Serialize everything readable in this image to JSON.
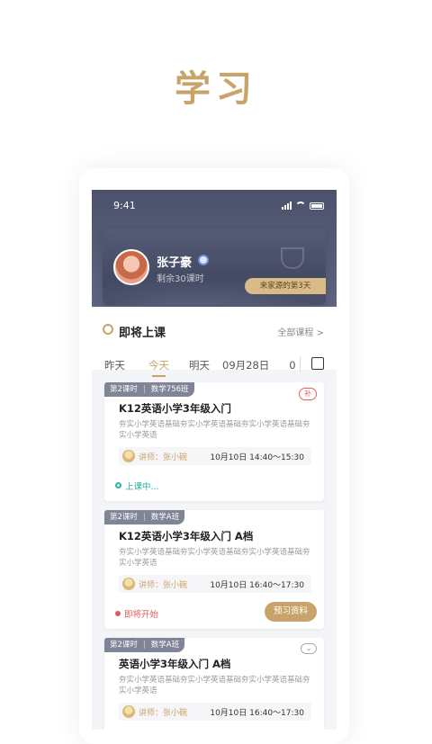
{
  "page": {
    "title": "学习"
  },
  "status_bar": {
    "time": "9:41"
  },
  "profile": {
    "name": "张子豪",
    "remaining": "剩余30课时",
    "badge": "来家源的第3天"
  },
  "upcoming": {
    "title": "即将上课",
    "all_link": "全部课程 >"
  },
  "tabs": [
    {
      "label": "昨天"
    },
    {
      "label": "今天"
    },
    {
      "label": "明天"
    },
    {
      "label": "09月28日"
    },
    {
      "label": "0"
    }
  ],
  "cards": [
    {
      "lesson": "第2课时",
      "class": "数学756班",
      "badge": "补",
      "title": "K12英语小学3年级入门",
      "desc": "夯实小学英语基础夯实小学英语基础夯实小学英语基础夯实小学英语",
      "teacher": "讲师：张小碗",
      "time": "10月10日  14:40～15:30",
      "status": "上课中..."
    },
    {
      "lesson": "第2课时",
      "class": "数学A班",
      "title": "K12英语小学3年级入门 A档",
      "desc": "夯实小学英语基础夯实小学英语基础夯实小学英语基础夯实小学英语",
      "teacher": "讲师：张小碗",
      "time": "10月10日  16:40～17:30",
      "status": "即将开始",
      "button": "预习资料"
    },
    {
      "lesson": "第2课时",
      "class": "数学A班",
      "title": "英语小学3年级入门 A档",
      "desc": "夯实小学英语基础夯实小学英语基础夯实小学英语基础夯实小学英语",
      "teacher": "讲师：张小碗",
      "time": "10月10日  16:40～17:30"
    }
  ],
  "colors": {
    "accent": "#c9a46a",
    "header": "#4c526b",
    "live": "#2bb3a8",
    "soon": "#e05a5a"
  }
}
